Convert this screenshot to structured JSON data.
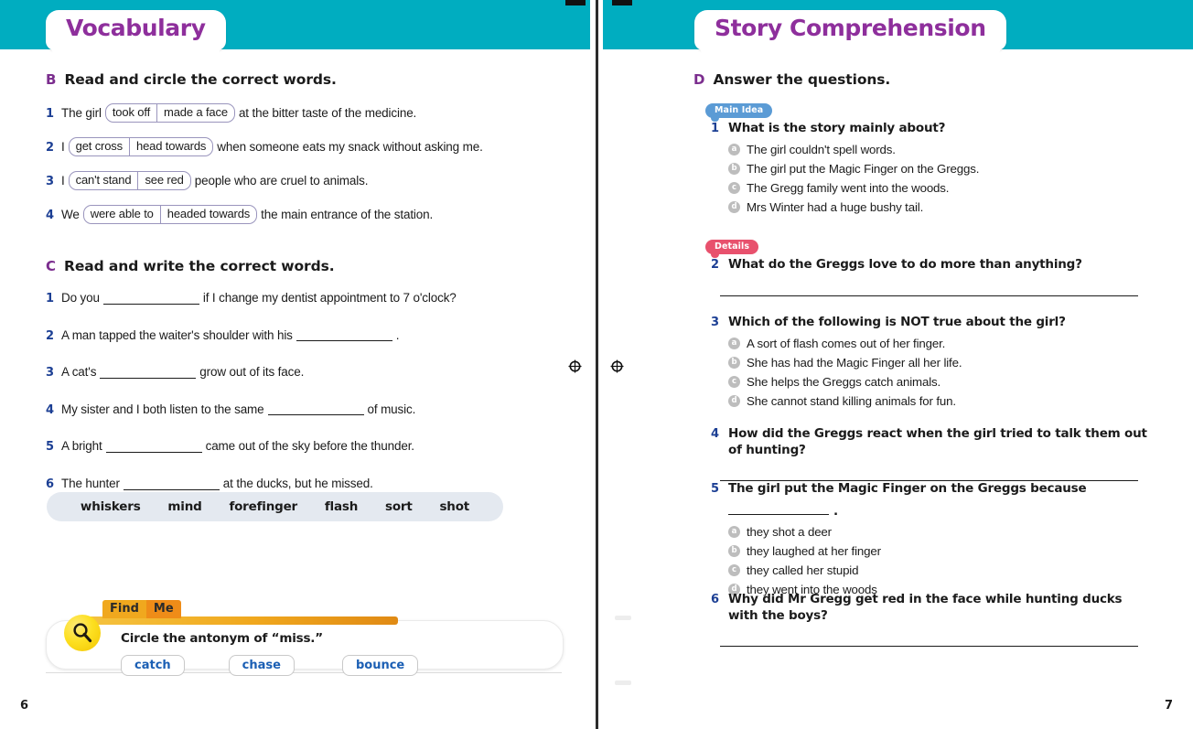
{
  "spread": {
    "left_page": {
      "page_number": "6",
      "tab_title": "Vocabulary",
      "exercise_b": {
        "letter": "B",
        "title": "Read and circle the correct words.",
        "items": [
          {
            "num": "1",
            "before": "The girl",
            "option_a": "took off",
            "option_b": "made a face",
            "after": "at the bitter taste of the medicine."
          },
          {
            "num": "2",
            "before": "I",
            "option_a": "get cross",
            "option_b": "head towards",
            "after": "when someone eats my snack without asking me."
          },
          {
            "num": "3",
            "before": "I",
            "option_a": "can't stand",
            "option_b": "see red",
            "after": "people who are cruel to animals."
          },
          {
            "num": "4",
            "before": "We",
            "option_a": "were able to",
            "option_b": "headed towards",
            "after": "the main entrance of the station."
          }
        ]
      },
      "exercise_c": {
        "letter": "C",
        "title": "Read and write the correct words.",
        "items": [
          {
            "num": "1",
            "before": "Do you",
            "after": "if I change my dentist appointment to 7 o'clock?"
          },
          {
            "num": "2",
            "before": "A man tapped the waiter's shoulder with his",
            "after": "."
          },
          {
            "num": "3",
            "before": "A cat's",
            "after": "grow out of its face."
          },
          {
            "num": "4",
            "before": "My sister and I both listen to the same",
            "after": "of music."
          },
          {
            "num": "5",
            "before": "A bright",
            "after": "came out of the sky before the thunder."
          },
          {
            "num": "6",
            "before": "The hunter",
            "after": "at the ducks, but he missed."
          }
        ],
        "word_bank": [
          "whiskers",
          "mind",
          "forefinger",
          "flash",
          "sort",
          "shot"
        ]
      },
      "find_me": {
        "tab_word_1": "Find",
        "tab_word_2": "Me",
        "prompt": "Circle the antonym of “miss.”",
        "options": [
          "catch",
          "chase",
          "bounce"
        ]
      }
    },
    "right_page": {
      "page_number": "7",
      "tab_title": "Story Comprehension",
      "exercise_d": {
        "letter": "D",
        "title": "Answer the questions.",
        "badges": {
          "main_idea": "Main Idea",
          "details": "Details"
        },
        "questions": [
          {
            "num": "1",
            "text": "What is the story mainly about?",
            "type": "choice",
            "options": [
              {
                "key": "a",
                "label": "The girl couldn't spell words."
              },
              {
                "key": "b",
                "label": "The girl put the Magic Finger on the Greggs."
              },
              {
                "key": "c",
                "label": "The Gregg family went into the woods."
              },
              {
                "key": "d",
                "label": "Mrs Winter had a huge bushy tail."
              }
            ]
          },
          {
            "num": "2",
            "text": "What do the Greggs love to do more than anything?",
            "type": "written"
          },
          {
            "num": "3",
            "text": "Which of the following is NOT true about the girl?",
            "type": "choice",
            "options": [
              {
                "key": "a",
                "label": "A sort of flash comes out of her finger."
              },
              {
                "key": "b",
                "label": "She has had the Magic Finger all her life."
              },
              {
                "key": "c",
                "label": "She helps the Greggs catch animals."
              },
              {
                "key": "d",
                "label": "She cannot stand killing animals for fun."
              }
            ]
          },
          {
            "num": "4",
            "text": "How did the Greggs react when the girl tried to talk them out of hunting?",
            "type": "written"
          },
          {
            "num": "5",
            "text_before": "The girl put the Magic Finger on the Greggs because",
            "text_after": ".",
            "type": "choice-blank",
            "options": [
              {
                "key": "a",
                "label": "they shot a deer"
              },
              {
                "key": "b",
                "label": "they laughed at her finger"
              },
              {
                "key": "c",
                "label": "they called her stupid"
              },
              {
                "key": "d",
                "label": "they went into the woods"
              }
            ]
          },
          {
            "num": "6",
            "text": "Why did Mr Gregg get red in the face while hunting ducks with the boys?",
            "type": "written"
          }
        ]
      }
    }
  },
  "colors": {
    "header_teal": "#00adc0",
    "tab_purple": "#8e2f9c",
    "number_blue": "#1c3f94",
    "badge_main_idea": "#5b9bd5",
    "badge_details": "#e8516d",
    "word_bank_bg": "#e4e9f0",
    "find_me_yellow": "#fde021",
    "find_me_orange": "#f0a81e",
    "option_link_blue": "#1b5fb4"
  }
}
